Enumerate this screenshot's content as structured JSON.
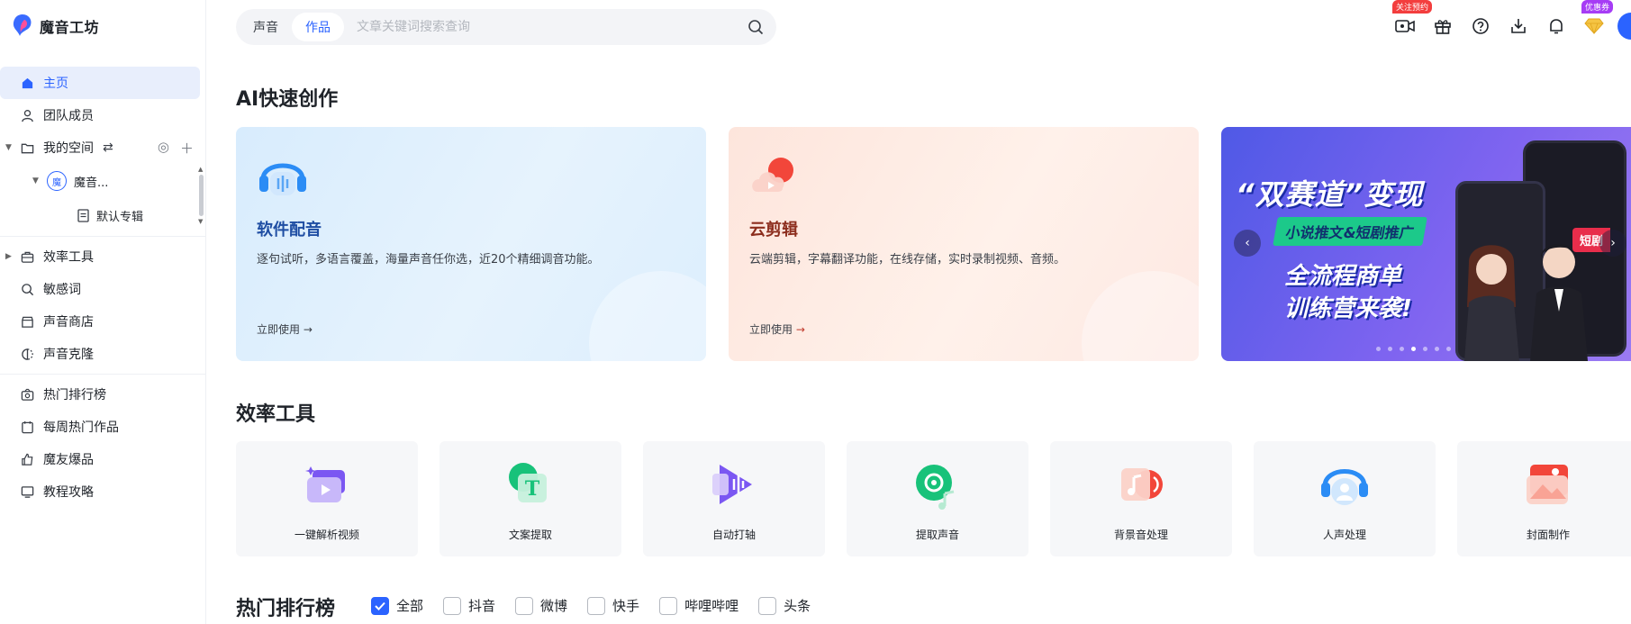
{
  "app": {
    "name": "魔音工坊"
  },
  "sidebar": {
    "items": [
      {
        "label": "主页",
        "icon": "home-icon"
      },
      {
        "label": "团队成员",
        "icon": "user-icon"
      },
      {
        "label": "我的空间",
        "icon": "folder-icon"
      },
      {
        "label": "效率工具",
        "icon": "briefcase-icon"
      },
      {
        "label": "敏感词",
        "icon": "search-shield-icon"
      },
      {
        "label": "声音商店",
        "icon": "store-icon"
      },
      {
        "label": "声音克隆",
        "icon": "clone-icon"
      },
      {
        "label": "热门排行榜",
        "icon": "hot-rank-icon"
      },
      {
        "label": "每周热门作品",
        "icon": "calendar-icon"
      },
      {
        "label": "魔友爆品",
        "icon": "thumbs-up-icon"
      },
      {
        "label": "教程攻略",
        "icon": "monitor-icon"
      }
    ],
    "space": {
      "workspace_avatar": "魔",
      "workspace_name": "魔音...",
      "album": "默认专辑"
    }
  },
  "search": {
    "tabs": [
      "声音",
      "作品"
    ],
    "active_tab": "作品",
    "placeholder": "文章关键词搜索查询"
  },
  "topbar": {
    "badge_follow": "关注预约",
    "badge_coupon": "优惠券"
  },
  "ai_section": {
    "title": "AI快速创作",
    "cards": [
      {
        "title": "软件配音",
        "desc": "逐句试听，多语言覆盖，海量声音任你选，近20个精细调音功能。",
        "link": "立即使用"
      },
      {
        "title": "云剪辑",
        "desc": "云端剪辑，字幕翻译功能，在线存储，实时录制视频、音频。",
        "link": "立即使用"
      }
    ],
    "banner": {
      "line1": "“双赛道”变现",
      "line2": "小说推文&短剧推广",
      "line3": "全流程商单",
      "line4": "训练营来袭!",
      "tag": "短剧"
    }
  },
  "tools_section": {
    "title": "效率工具",
    "tools": [
      {
        "label": "一键解析视频",
        "icon": "video-parse-icon"
      },
      {
        "label": "文案提取",
        "icon": "text-extract-icon"
      },
      {
        "label": "自动打轴",
        "icon": "auto-timeline-icon"
      },
      {
        "label": "提取声音",
        "icon": "extract-audio-icon"
      },
      {
        "label": "背景音处理",
        "icon": "bg-music-icon"
      },
      {
        "label": "人声处理",
        "icon": "voice-process-icon"
      },
      {
        "label": "封面制作",
        "icon": "cover-icon"
      }
    ]
  },
  "hot_section": {
    "title": "热门排行榜",
    "filters": [
      {
        "label": "全部",
        "checked": true
      },
      {
        "label": "抖音",
        "checked": false
      },
      {
        "label": "微博",
        "checked": false
      },
      {
        "label": "快手",
        "checked": false
      },
      {
        "label": "哔哩哔哩",
        "checked": false
      },
      {
        "label": "头条",
        "checked": false
      }
    ]
  },
  "colors": {
    "accent": "#2b63ff",
    "active_bg": "#e8eefc"
  }
}
